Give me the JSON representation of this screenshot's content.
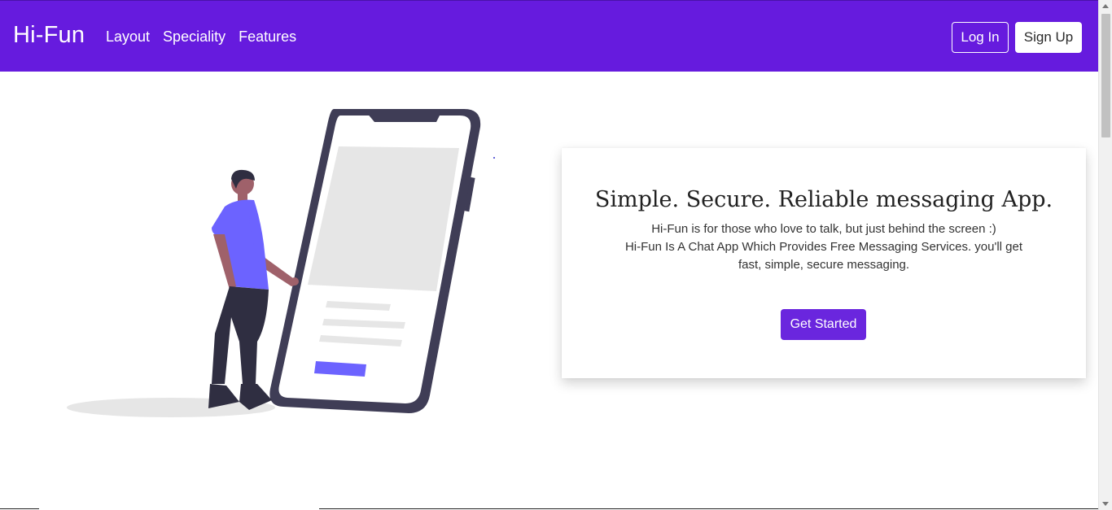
{
  "brand": {
    "name": "Hi-Fun"
  },
  "nav": {
    "links": [
      "Layout",
      "Speciality",
      "Features"
    ],
    "login_label": "Log In",
    "signup_label": "Sign Up"
  },
  "hero": {
    "title": "Simple. Secure. Reliable messaging App.",
    "line1": "Hi-Fun is for those who love to talk, but just behind the screen :)",
    "line2": "Hi-Fun Is A Chat App Which Provides Free Messaging Services. you'll get fast, simple, secure messaging.",
    "cta_label": "Get Started",
    "illustration_icon": "person-with-phone-illustration"
  },
  "colors": {
    "brand_purple": "#661bde",
    "button_purple": "#6a26de",
    "phone_frame": "#3f3d56",
    "accent_blue": "#6c63ff"
  }
}
